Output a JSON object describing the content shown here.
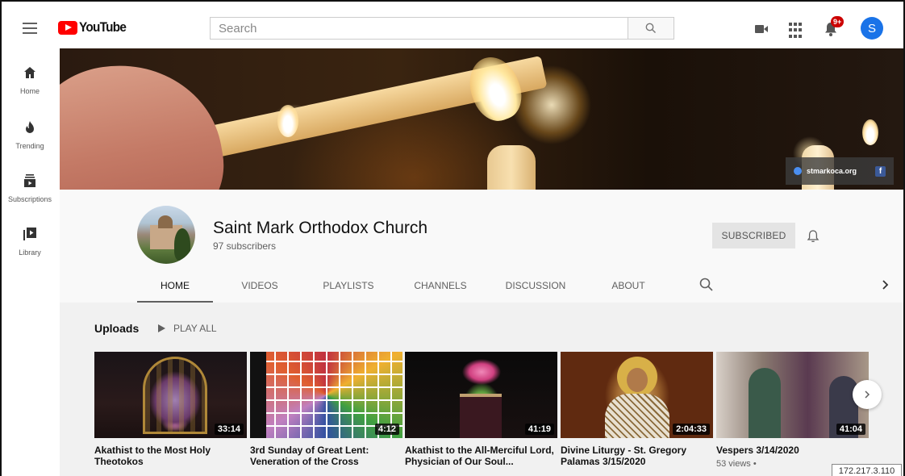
{
  "header": {
    "logo_text": "YouTube",
    "search_placeholder": "Search",
    "notification_count": "9+",
    "avatar_letter": "S"
  },
  "sidebar": {
    "items": [
      {
        "label": "Home",
        "icon": "home-icon"
      },
      {
        "label": "Trending",
        "icon": "flame-icon"
      },
      {
        "label": "Subscriptions",
        "icon": "subscriptions-icon"
      },
      {
        "label": "Library",
        "icon": "library-icon"
      }
    ]
  },
  "banner": {
    "link_text": "stmarkoca.org",
    "social_icon": "facebook-icon"
  },
  "channel": {
    "name": "Saint Mark Orthodox Church",
    "subscribers": "97 subscribers",
    "subscribe_label": "SUBSCRIBED"
  },
  "tabs": [
    {
      "label": "HOME",
      "active": true
    },
    {
      "label": "VIDEOS",
      "active": false
    },
    {
      "label": "PLAYLISTS",
      "active": false
    },
    {
      "label": "CHANNELS",
      "active": false
    },
    {
      "label": "DISCUSSION",
      "active": false
    },
    {
      "label": "ABOUT",
      "active": false
    }
  ],
  "uploads": {
    "title": "Uploads",
    "play_all": "PLAY ALL",
    "videos": [
      {
        "title": "Akathist to the Most Holy Theotokos",
        "duration": "33:14",
        "meta": ""
      },
      {
        "title": "3rd Sunday of Great Lent: Veneration of the Cross",
        "duration": "4:12",
        "meta": ""
      },
      {
        "title": "Akathist to the All-Merciful Lord, Physician of Our Soul...",
        "duration": "41:19",
        "meta": ""
      },
      {
        "title": "Divine Liturgy - St. Gregory Palamas 3/15/2020",
        "duration": "2:04:33",
        "meta": ""
      },
      {
        "title": "Vespers 3/14/2020",
        "duration": "41:04",
        "meta": "53 views •"
      }
    ]
  },
  "overlay": {
    "ip_address": "172.217.3.110"
  },
  "colors": {
    "brand_red": "#ff0000",
    "avatar_blue": "#1a73e8",
    "badge_red": "#cc0000"
  }
}
